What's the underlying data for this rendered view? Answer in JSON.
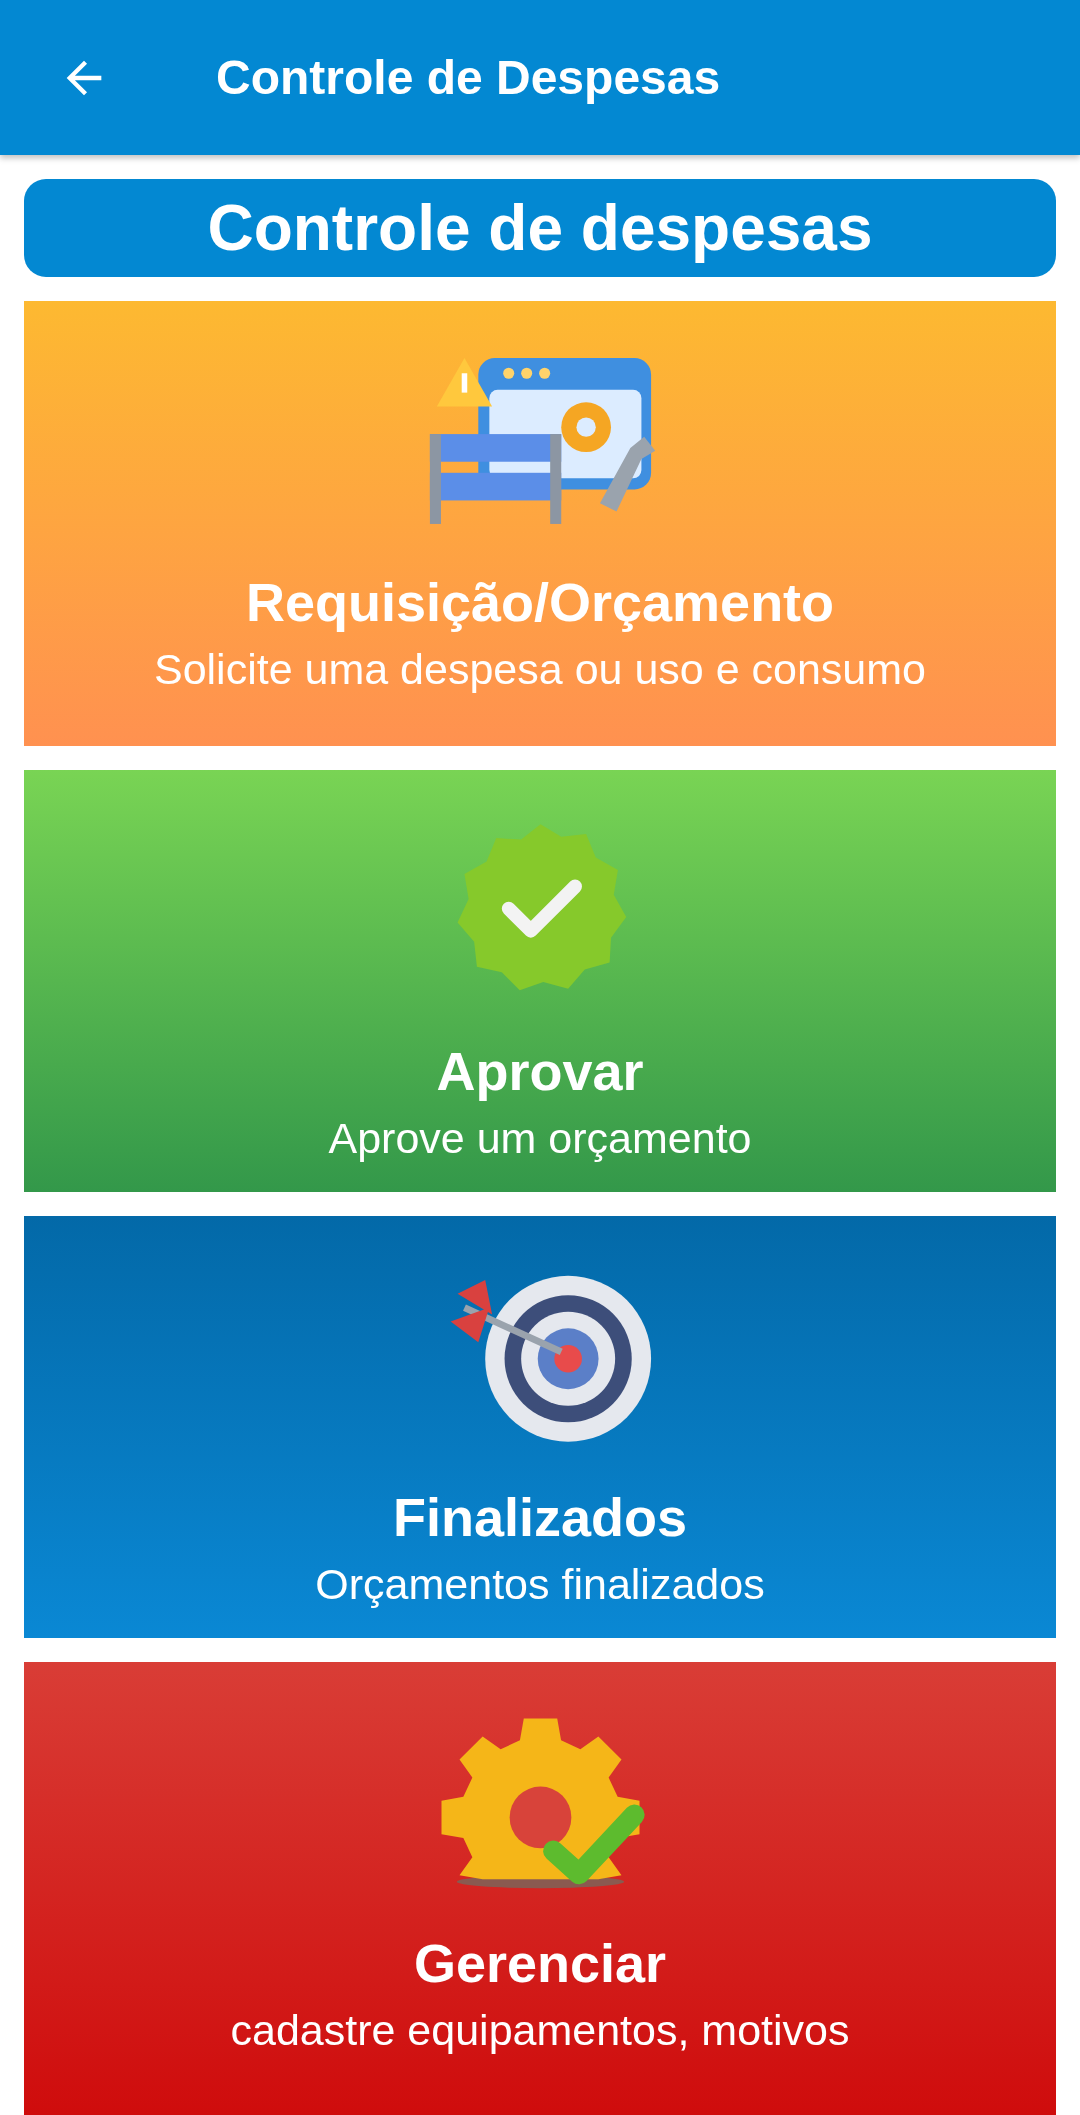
{
  "app_bar": {
    "title": "Controle de Despesas"
  },
  "heading": "Controle de despesas",
  "cards": [
    {
      "kind": "tools",
      "title": "Requisição/Orçamento",
      "subtitle": "Solicite uma despesa ou uso e consumo"
    },
    {
      "kind": "badge",
      "title": "Aprovar",
      "subtitle": "Aprove um orçamento"
    },
    {
      "kind": "target",
      "title": "Finalizados",
      "subtitle": "Orçamentos finalizados"
    },
    {
      "kind": "gear",
      "title": "Gerenciar",
      "subtitle": "cadastre equipamentos, motivos"
    }
  ]
}
